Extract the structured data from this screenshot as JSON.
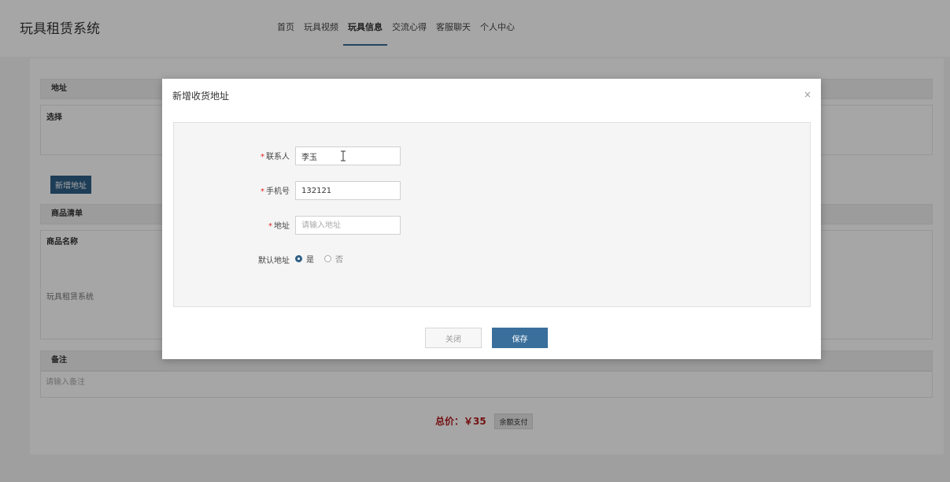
{
  "header": {
    "brand": "玩具租赁系统",
    "nav": [
      {
        "label": "首页",
        "active": false
      },
      {
        "label": "玩具视频",
        "active": false
      },
      {
        "label": "玩具信息",
        "active": true
      },
      {
        "label": "交流心得",
        "active": false
      },
      {
        "label": "客服聊天",
        "active": false
      },
      {
        "label": "个人中心",
        "active": false
      }
    ]
  },
  "page": {
    "address_section": "地址",
    "choose_label": "选择",
    "add_address_button": "新增地址",
    "goods_section": "商品清单",
    "goods_name_label": "商品名称",
    "goods_item": "玩具租赁系统",
    "note_section": "备注",
    "note_placeholder": "请输入备注",
    "total": "总价：￥35",
    "balance_pay_button": "余额支付"
  },
  "modal": {
    "title": "新增收货地址",
    "close_symbol": "×",
    "fields": {
      "contact": {
        "label": "联系人",
        "value": "李玉",
        "required": true
      },
      "phone": {
        "label": "手机号",
        "value": "132121",
        "required": true
      },
      "address": {
        "label": "地址",
        "placeholder": "请输入地址",
        "value": "",
        "required": true
      }
    },
    "default_address": {
      "label": "默认地址",
      "options": [
        "是",
        "否"
      ],
      "selected": "是"
    },
    "close_button": "关闭",
    "save_button": "保存"
  },
  "colors": {
    "accent": "#2f5f86",
    "save": "#3a6f9c",
    "price": "#b31b1b",
    "required": "#e02020"
  }
}
